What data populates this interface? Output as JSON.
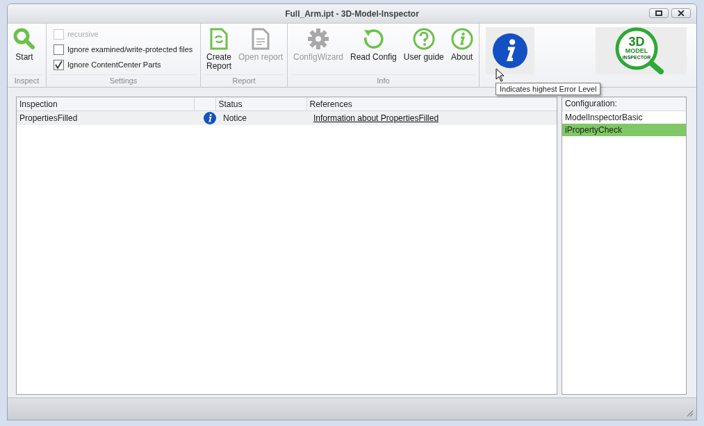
{
  "window": {
    "title": "Full_Arm.ipt - 3D-Model-Inspector"
  },
  "ribbon": [
    {
      "label": "Inspect",
      "items": [
        {
          "kind": "button",
          "label": "Start",
          "disabled": false
        }
      ]
    },
    {
      "label": "Settings",
      "items": [
        {
          "kind": "checkbox",
          "label": "recursive",
          "checked": false,
          "disabled": true
        },
        {
          "kind": "checkbox",
          "label": "Ignore examined/write-protected files",
          "checked": false,
          "disabled": false
        },
        {
          "kind": "checkbox",
          "label": "Ignore ContentCenter Parts",
          "checked": true,
          "disabled": false
        }
      ]
    },
    {
      "label": "Report",
      "items": [
        {
          "kind": "button",
          "label": "Create\nReport",
          "disabled": false
        },
        {
          "kind": "button",
          "label": "Open report",
          "disabled": true
        }
      ]
    },
    {
      "label": "Info",
      "items": [
        {
          "kind": "button",
          "label": "ConfigWizard",
          "disabled": true
        },
        {
          "kind": "button",
          "label": "Read Config",
          "disabled": false
        },
        {
          "kind": "button",
          "label": "User guide",
          "disabled": false
        },
        {
          "kind": "button",
          "label": "About",
          "disabled": false
        }
      ]
    }
  ],
  "logo": {
    "line_1": "3D",
    "line_2": "MODEL",
    "line_3": "INSPECTOR"
  },
  "tooltip": "Indicates highest Error Level",
  "table": {
    "columns": [
      "Inspection",
      "Status",
      "References"
    ],
    "rows": [
      {
        "inspection": "PropertiesFilled",
        "status": "Notice",
        "reference": "Information about PropertiesFilled",
        "selected": true
      }
    ]
  },
  "configuration": {
    "title": "Configuration:",
    "items": [
      {
        "label": "ModelInspectorBasic",
        "selected": false
      },
      {
        "label": "iPropertyCheck",
        "selected": true
      }
    ]
  }
}
